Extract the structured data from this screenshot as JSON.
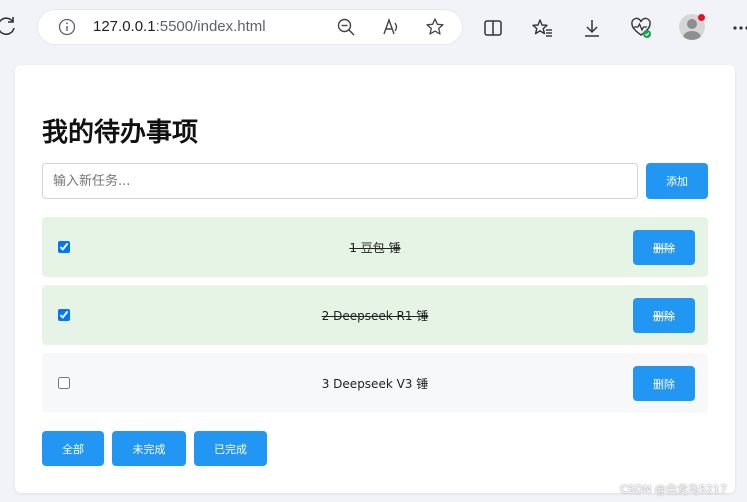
{
  "browser": {
    "url_host": "127.0.0.1",
    "url_rest": ":5500/index.html",
    "icons": [
      "reload-icon",
      "info-icon",
      "zoom-out-icon",
      "read-aloud-icon",
      "favorite-star-icon",
      "split-screen-icon",
      "favorites-icon",
      "download-icon",
      "browser-health-icon",
      "profile-avatar",
      "more-icon"
    ]
  },
  "page": {
    "title": "我的待办事项",
    "input_placeholder": "输入新任务...",
    "add_label": "添加",
    "tasks": [
      {
        "text": "1 豆包 锤",
        "done": true,
        "delete_label": "删除"
      },
      {
        "text": "2 Deepseek R1 锤",
        "done": true,
        "delete_label": "删除"
      },
      {
        "text": "3 Deepseek V3 锤",
        "done": false,
        "delete_label": "删除"
      }
    ],
    "filters": {
      "all": "全部",
      "active": "未完成",
      "completed": "已完成"
    }
  },
  "watermark": "CSDN @白龙马5217",
  "colors": {
    "accent": "#2196f3",
    "done_bg": "#e6f4e6",
    "todo_bg": "#f7f8fa",
    "page_bg": "#f1f3f9"
  }
}
